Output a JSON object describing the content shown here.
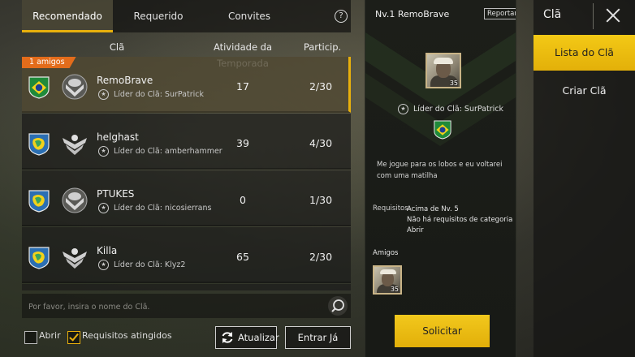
{
  "tabs": [
    {
      "label": "Recomendado",
      "active": true
    },
    {
      "label": "Requerido",
      "active": false
    },
    {
      "label": "Convites",
      "active": false
    }
  ],
  "table": {
    "headers": {
      "clan": "Clã",
      "activity": "Atividade da Temporada",
      "members": "Particip."
    },
    "rows": [
      {
        "badge": "1 amigos",
        "name": "RemoBrave",
        "leader": "Líder do Clã: SurPatrick",
        "activity": "17",
        "members": "2/30",
        "selected": true,
        "shield": "brazil"
      },
      {
        "badge": "",
        "name": "helghast",
        "leader": "Líder do Clã: amberhammer",
        "activity": "39",
        "members": "4/30",
        "selected": false,
        "shield": "map"
      },
      {
        "badge": "",
        "name": "PTUKES",
        "leader": "Líder do Clã: nicosierrans",
        "activity": "0",
        "members": "1/30",
        "selected": false,
        "shield": "map"
      },
      {
        "badge": "",
        "name": "Killa",
        "leader": "Líder do Clã: Klyz2",
        "activity": "65",
        "members": "2/30",
        "selected": false,
        "shield": "map"
      }
    ]
  },
  "search": {
    "placeholder": "Por favor, insira o nome do Clã."
  },
  "filters": {
    "open_label": "Abrir",
    "open_checked": false,
    "requirements_label": "Requisitos atingidos",
    "requirements_checked": true
  },
  "buttons": {
    "refresh": "Atualizar",
    "join": "Entrar Já"
  },
  "detail": {
    "title": "Nv.1 RemoBrave",
    "report": "Reportar",
    "avatar_level": "35",
    "leader": "Líder do Clã: SurPatrick",
    "motto": "Me jogue para os lobos e eu voltarei com uma matilha",
    "requirements_label": "Requisitos:",
    "requirements": [
      "Acima de Nv. 5",
      "Não há requisitos de categoria",
      "Abrir"
    ],
    "friends_label": "Amigos",
    "friend_level": "35",
    "apply": "Solicitar"
  },
  "menu": {
    "title": "Clã",
    "items": [
      {
        "label": "Lista do Clã",
        "active": true
      },
      {
        "label": "Criar Clã",
        "active": false
      }
    ]
  },
  "colors": {
    "accent": "#e8b00c",
    "friends_badge": "#e36c1b",
    "brazil_green": "#1f8a3a",
    "brazil_yellow": "#f2d21b"
  }
}
